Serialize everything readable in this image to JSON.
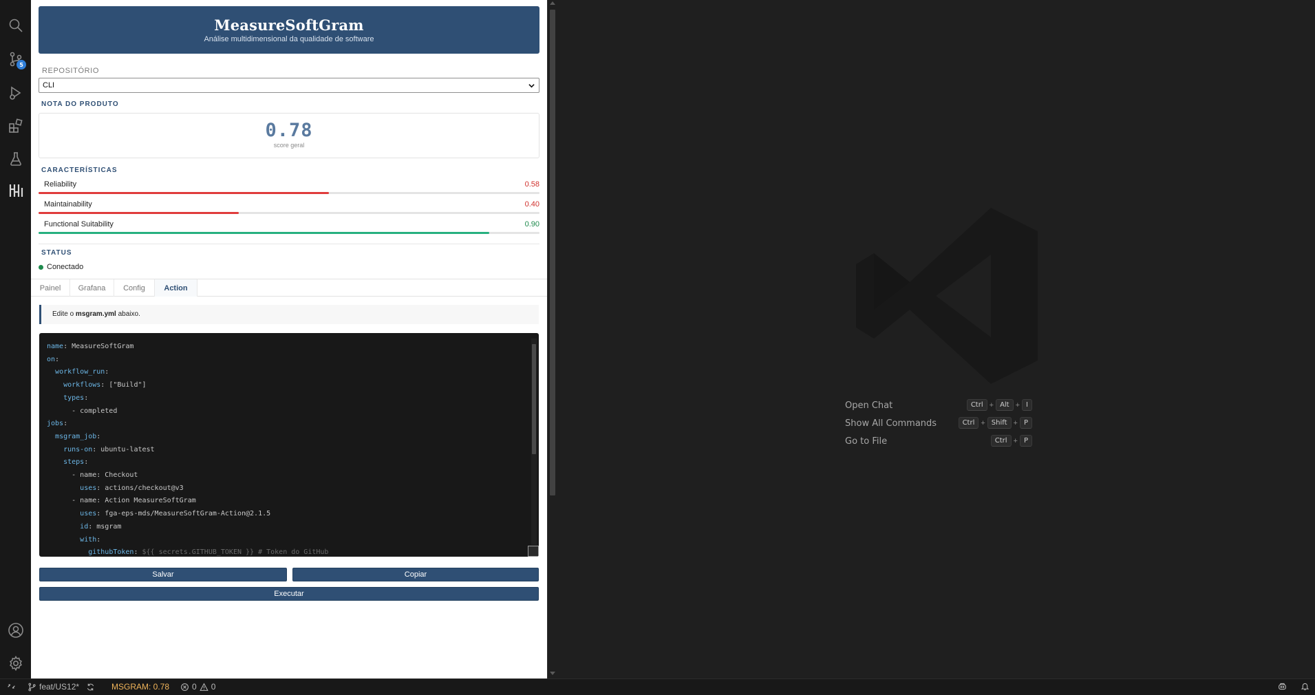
{
  "app": {
    "name": "MeasureSoftGram",
    "subtitle": "Análise multidimensional da qualidade de software"
  },
  "activity_bar": {
    "scm_badge": "5",
    "icons": [
      "search-icon",
      "source-control-icon",
      "run-debug-icon",
      "extensions-icon",
      "testing-icon",
      "msgram-icon",
      "account-icon",
      "settings-gear-icon"
    ]
  },
  "repository": {
    "label": "REPOSITÓRIO",
    "selected": "CLI"
  },
  "product_score": {
    "section_title": "NOTA DO PRODUTO",
    "value": "0.78",
    "label": "score geral"
  },
  "characteristics": {
    "section_title": "CARACTERÍSTICAS",
    "items": [
      {
        "name": "Reliability",
        "value": "0.58",
        "score": 0.58,
        "color": "#e03c3c"
      },
      {
        "name": "Maintainability",
        "value": "0.40",
        "score": 0.4,
        "color": "#e03c3c"
      },
      {
        "name": "Functional Suitability",
        "value": "0.90",
        "score": 0.9,
        "color": "#27b07f"
      }
    ]
  },
  "status": {
    "section_title": "STATUS",
    "text": "Conectado",
    "color": "#1e8a4d"
  },
  "tabs": [
    {
      "label": "Painel",
      "active": false
    },
    {
      "label": "Grafana",
      "active": false
    },
    {
      "label": "Config",
      "active": false
    },
    {
      "label": "Action",
      "active": true
    }
  ],
  "info": {
    "prefix": "Edite o ",
    "file": "msgram.yml",
    "suffix": " abaixo."
  },
  "editor": {
    "lines": [
      [
        [
          "k",
          "name"
        ],
        [
          "t",
          ": MeasureSoftGram"
        ]
      ],
      [
        [
          "k",
          "on"
        ],
        [
          "t",
          ":"
        ]
      ],
      [
        [
          "t",
          "  "
        ],
        [
          "k",
          "workflow_run"
        ],
        [
          "t",
          ":"
        ]
      ],
      [
        [
          "t",
          "    "
        ],
        [
          "k",
          "workflows"
        ],
        [
          "t",
          ": [\"Build\"]"
        ]
      ],
      [
        [
          "t",
          "    "
        ],
        [
          "k",
          "types"
        ],
        [
          "t",
          ":"
        ]
      ],
      [
        [
          "t",
          "      - completed"
        ]
      ],
      [
        [
          "k",
          "jobs"
        ],
        [
          "t",
          ":"
        ]
      ],
      [
        [
          "t",
          "  "
        ],
        [
          "k",
          "msgram_job"
        ],
        [
          "t",
          ":"
        ]
      ],
      [
        [
          "t",
          "    "
        ],
        [
          "k",
          "runs-on"
        ],
        [
          "t",
          ": ubuntu-latest"
        ]
      ],
      [
        [
          "t",
          "    "
        ],
        [
          "k",
          "steps"
        ],
        [
          "t",
          ":"
        ]
      ],
      [
        [
          "t",
          "      - name: Checkout"
        ]
      ],
      [
        [
          "t",
          "        "
        ],
        [
          "k",
          "uses"
        ],
        [
          "t",
          ": actions/checkout@v3"
        ]
      ],
      [
        [
          "t",
          "      - name: Action MeasureSoftGram"
        ]
      ],
      [
        [
          "t",
          "        "
        ],
        [
          "k",
          "uses"
        ],
        [
          "t",
          ": fga-eps-mds/MeasureSoftGram-Action@2.1.5"
        ]
      ],
      [
        [
          "t",
          "        "
        ],
        [
          "k",
          "id"
        ],
        [
          "t",
          ": msgram"
        ]
      ],
      [
        [
          "t",
          "        "
        ],
        [
          "k",
          "with"
        ],
        [
          "t",
          ":"
        ]
      ],
      [
        [
          "t",
          "          "
        ],
        [
          "k",
          "githubToken"
        ],
        [
          "t",
          ": "
        ],
        [
          "c",
          "${{ secrets.GITHUB_TOKEN }} # Token do GitHub"
        ]
      ]
    ]
  },
  "buttons": {
    "save": "Salvar",
    "copy": "Copiar",
    "run": "Executar"
  },
  "welcome": {
    "commands": [
      {
        "label": "Open Chat",
        "keys": [
          "Ctrl",
          "Alt",
          "I"
        ]
      },
      {
        "label": "Show All Commands",
        "keys": [
          "Ctrl",
          "Shift",
          "P"
        ]
      },
      {
        "label": "Go to File",
        "keys": [
          "Ctrl",
          "P"
        ]
      }
    ]
  },
  "status_bar": {
    "branch": "feat/US12*",
    "msgram": "MSGRAM: 0.78",
    "errors": "0",
    "warnings": "0"
  }
}
